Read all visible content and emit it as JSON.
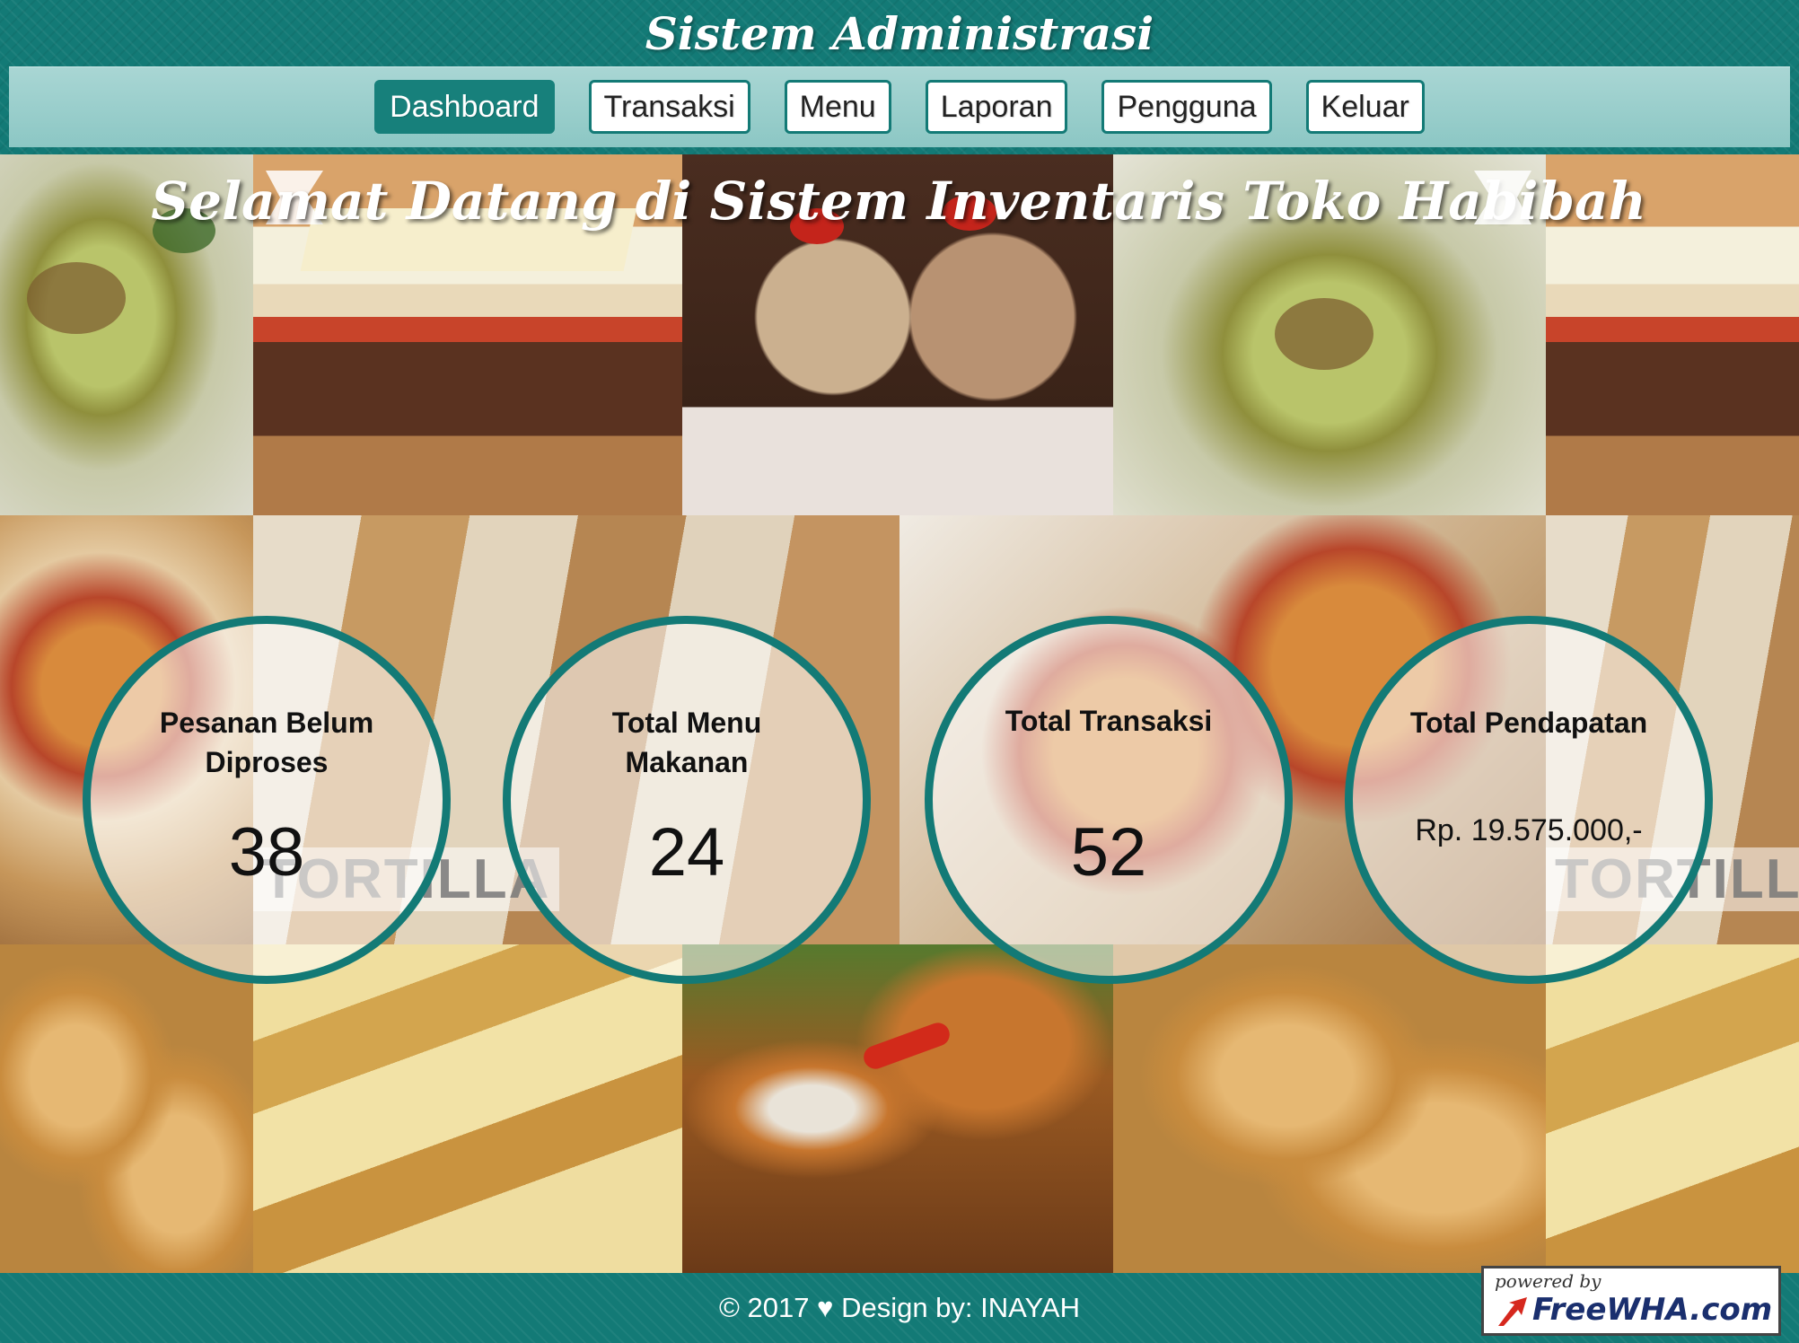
{
  "app": {
    "title": "Sistem Administrasi"
  },
  "nav": {
    "items": [
      {
        "label": "Dashboard",
        "active": true
      },
      {
        "label": "Transaksi",
        "active": false
      },
      {
        "label": "Menu",
        "active": false
      },
      {
        "label": "Laporan",
        "active": false
      },
      {
        "label": "Pengguna",
        "active": false
      },
      {
        "label": "Keluar",
        "active": false
      }
    ]
  },
  "banner": {
    "welcome": "Selamat Datang di Sistem Inventaris Toko Habibah"
  },
  "collage": {
    "photo_label": "TORTILLA"
  },
  "stats": [
    {
      "label": "Pesanan Belum Diproses",
      "value": "38"
    },
    {
      "label": "Total Menu Makanan",
      "value": "24"
    },
    {
      "label": "Total Transaksi",
      "value": "52"
    },
    {
      "label": "Total Pendapatan",
      "value": "Rp. 19.575.000,-"
    }
  ],
  "footer": {
    "text": "© 2017 ♥ Design by: INAYAH",
    "powered_by": "powered by",
    "powered_brand": "FreeWHA.com"
  },
  "colors": {
    "primary": "#137a76",
    "nav_bg": "#a9d6d4",
    "active_button": "#17807b",
    "text_light": "#ffffff"
  }
}
